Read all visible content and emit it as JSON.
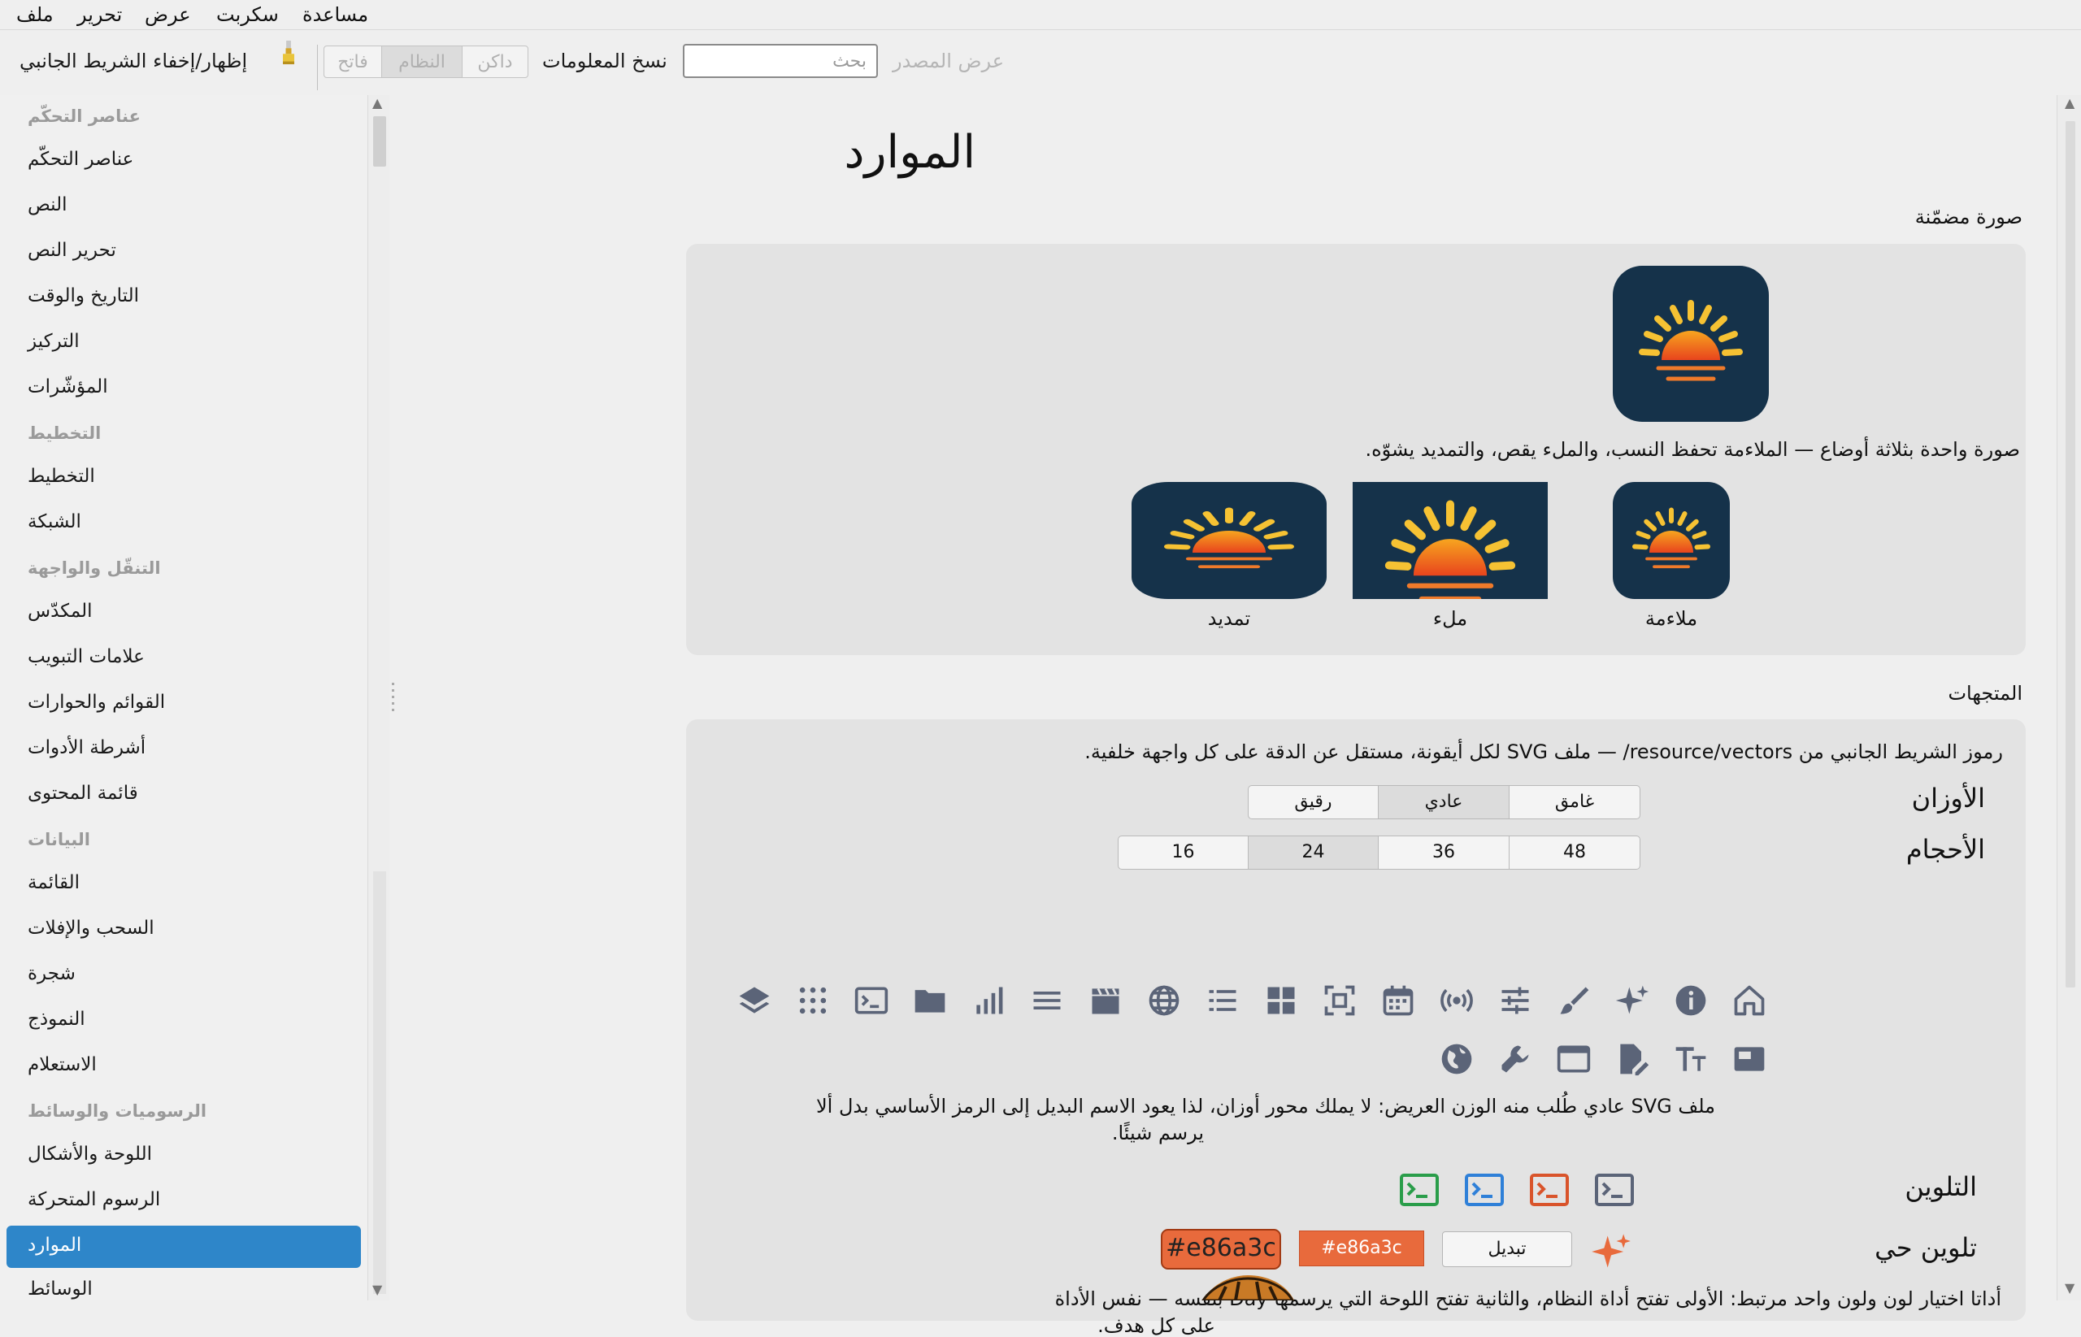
{
  "menubar": {
    "items": [
      "ملف",
      "تحرير",
      "عرض",
      "سكربت",
      "مساعدة"
    ]
  },
  "toolbar": {
    "sidebar_toggle": "إظهار/إخفاء الشريط الجانبي",
    "theme_segments": [
      "فاتح",
      "النظام",
      "داكن"
    ],
    "copy_info": "نسخ المعلومات",
    "search_placeholder": "بحث",
    "view_source": "عرض المصدر"
  },
  "sidebar": {
    "groups": [
      {
        "header": "عناصر التحكّم",
        "items": [
          "عناصر التحكّم",
          "النص",
          "تحرير النص",
          "التاريخ والوقت",
          "التركيز",
          "المؤشّرات"
        ]
      },
      {
        "header": "التخطيط",
        "items": [
          "التخطيط",
          "الشبكة"
        ]
      },
      {
        "header": "التنقّل والواجهة",
        "items": [
          "المكدّس",
          "علامات التبويب",
          "القوائم والحوارات",
          "أشرطة الأدوات",
          "قائمة المحتوى"
        ]
      },
      {
        "header": "البيانات",
        "items": [
          "القائمة",
          "السحب والإفلات",
          "شجرة",
          "النموذج",
          "الاستعلام"
        ]
      },
      {
        "header": "الرسوميات والوسائط",
        "items": [
          "اللوحة والأشكال",
          "الرسوم المتحركة",
          "الموارد",
          "الوسائط"
        ]
      }
    ],
    "selected": "الموارد"
  },
  "main": {
    "title": "الموارد",
    "embedded": {
      "label": "صورة مضمّنة",
      "description": "صورة واحدة بثلاثة أوضاع — الملاءمة تحفظ النسب، والملء يقص، والتمديد يشوّه.",
      "modes": [
        "ملاءمة",
        "ملء",
        "تمديد"
      ]
    },
    "vectors": {
      "label": "المتجهات",
      "description": "رموز الشريط الجانبي من resource/vectors/ — ملف SVG لكل أيقونة، مستقل عن الدقة على كل واجهة خلفية.",
      "weights_label": "الأوزان",
      "weights": [
        "غامق",
        "عادي",
        "رقيق"
      ],
      "weights_selected": "عادي",
      "sizes_label": "الأحجام",
      "sizes": [
        "48",
        "36",
        "24",
        "16"
      ],
      "sizes_selected": "24",
      "icons_row1": [
        "home-icon",
        "info-icon",
        "sparkle-icon",
        "brush-icon",
        "sliders-icon",
        "broadcast-icon",
        "calendar-icon",
        "focus-icon",
        "grid-icon",
        "list-icon",
        "globe-icon",
        "clapperboard-icon",
        "menu-icon",
        "bar-chart-icon",
        "folder-icon",
        "terminal-icon",
        "dots-grid-icon",
        "layers-icon"
      ],
      "icons_row2": [
        "sidebar-icon",
        "text-size-icon",
        "edit-document-icon",
        "window-icon",
        "wrench-icon",
        "globe-filled-icon"
      ],
      "fallback_note_line1": "ملف SVG عادي طُلب منه الوزن العريض: لا يملك محور أوزان، لذا يعود الاسم البديل إلى الرمز الأساسي بدل ألا",
      "fallback_note_line2": "يرسم شيئًا.",
      "tint_label": "التلوين",
      "tint_colors": [
        "#5b6478",
        "#d9542b",
        "#2f80d8",
        "#2a9d4a"
      ],
      "live_tint_label": "تلوين حي",
      "toggle_label": "تبديل",
      "color_value": "#e86a3c",
      "color_hex_label": "#e86a3c",
      "picker_note_line1": "أداتا اختيار لون ولون واحد مرتبط: الأولى تفتح أداة النظام، والثانية تفتح اللوحة التي يرسمها Day بنفسه — نفس الأداة",
      "picker_note_line2": "على كل هدف."
    }
  },
  "colors": {
    "accent": "#2e86c9",
    "sun_bg": "#15324a",
    "live_tint": "#e86a3c"
  }
}
